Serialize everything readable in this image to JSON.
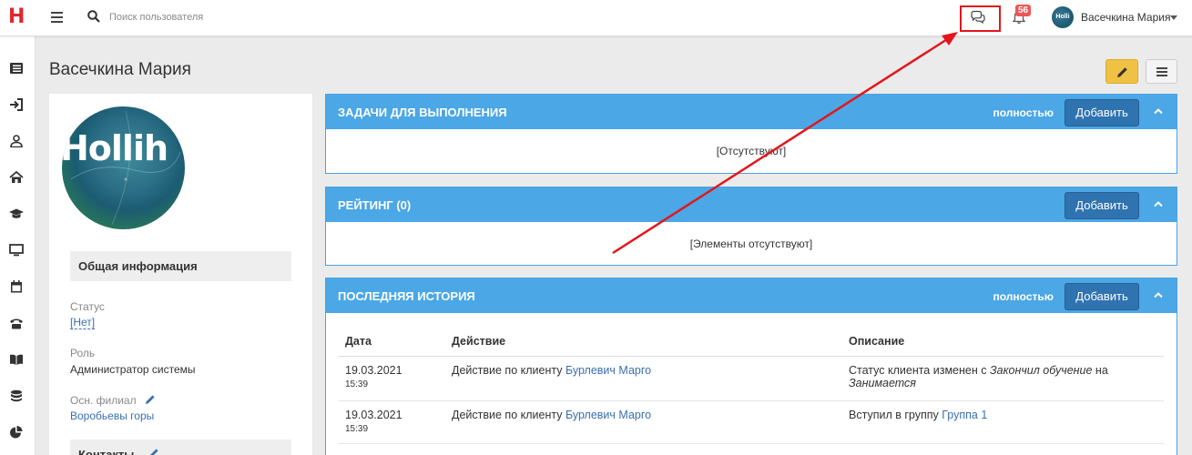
{
  "app": {
    "logo_letter": "H",
    "brand_color": "#e3262e"
  },
  "header": {
    "search_placeholder": "Поиск пользователя",
    "notifications_count": "56",
    "user_name": "Васечкина Мария",
    "avatar_text": "Holli"
  },
  "sidebar": {
    "icons": [
      "list-icon",
      "sign-in-icon",
      "user-icon",
      "home-icon",
      "graduation-cap-icon",
      "monitor-icon",
      "calendar-icon",
      "phone-icon",
      "book-icon",
      "database-icon",
      "pie-chart-icon"
    ]
  },
  "page": {
    "title": "Васечкина Мария"
  },
  "profile": {
    "avatar_text": "Hollih",
    "general_header": "Общая информация",
    "status_label": "Статус",
    "status_value": "[Нет]",
    "role_label": "Роль",
    "role_value": "Администратор системы",
    "branch_label": "Осн. филиал",
    "branch_value": "Воробьевы горы",
    "contacts_header": "Контакты"
  },
  "panels": {
    "tasks": {
      "title": "ЗАДАЧИ ДЛЯ ВЫПОЛНЕНИЯ",
      "full": "полностью",
      "add": "Добавить",
      "empty": "[Отсутствуют]"
    },
    "rating": {
      "title": "РЕЙТИНГ (0)",
      "add": "Добавить",
      "empty": "[Элементы отсутствуют]"
    },
    "history": {
      "title": "ПОСЛЕДНЯЯ ИСТОРИЯ",
      "full": "полностью",
      "add": "Добавить",
      "columns": [
        "Дата",
        "Действие",
        "Описание"
      ],
      "rows": [
        {
          "date": "19.03.2021",
          "time": "15:39",
          "action": "Действие по клиенту",
          "client": "Бурлевич Марго",
          "desc_pre": "Статус клиента изменен с",
          "desc_from": "Закончил обучение",
          "desc_mid": "на",
          "desc_to": "Занимается"
        },
        {
          "date": "19.03.2021",
          "time": "15:39",
          "action": "Действие по клиенту",
          "client": "Бурлевич Марго",
          "desc_pre": "Вступил в группу",
          "desc_link": "Группа 1"
        }
      ]
    }
  },
  "annotation": {
    "color": "#e3161c"
  }
}
